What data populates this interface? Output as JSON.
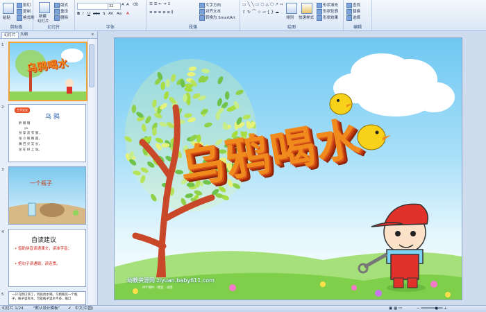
{
  "ribbon": {
    "groups": {
      "clipboard": "剪贴板",
      "slides": "幻灯片",
      "font": "字体",
      "paragraph": "段落",
      "drawing": "绘图",
      "editing": "编辑"
    },
    "clipboard": {
      "paste": "粘贴",
      "cut": "剪切",
      "copy": "复制",
      "format_painter": "格式刷"
    },
    "slides": {
      "new_slide": "新建",
      "new_slide2": "幻灯片",
      "layout": "版式",
      "reset": "重设",
      "delete": "删除"
    },
    "font": {
      "size": "32"
    },
    "paragraph": {
      "text_direction": "文字方向",
      "align_text": "对齐文本",
      "smartart": "转换为 SmartArt"
    },
    "drawing": {
      "arrange": "排列",
      "quick_styles": "快速样式",
      "shape_fill": "形状填充",
      "shape_outline": "形状轮廓",
      "shape_effects": "形状效果"
    },
    "editing": {
      "find": "查找",
      "replace": "替换",
      "select": "选择"
    }
  },
  "panel": {
    "tab_slides": "幻灯片",
    "tab_outline": "大纲",
    "thumbs": [
      {
        "num": "1",
        "title": "乌鸦喝水"
      },
      {
        "num": "2",
        "title": "乌 鸦",
        "header": "生字宝宝",
        "lines": [
          "胖 嘟 嘟",
          "ya",
          "身 穿 黑 衣 服 ，",
          "张 小 眼 睛 圆，",
          "嘴 巴 尖 又 长，",
          "总 在 树 上 站。"
        ]
      },
      {
        "num": "3",
        "title": "一个瓶子"
      },
      {
        "num": "4",
        "title": "自读建议",
        "bullets": [
          "借助拼音读通课文，读准字音；",
          "把句子读通顺，读连贯。"
        ]
      },
      {
        "num": "5",
        "text": "一只乌鸦口渴了，到处找水喝。乌鸦看见一个瓶子，瓶子里有水。可是瓶子里水不多，瓶口"
      }
    ]
  },
  "slide": {
    "title": "乌鸦喝水",
    "watermark": "幼教资源网 ziyuan.baby611.com",
    "watermark_sub": "PPT课件 · 教案 · 试卷"
  },
  "status": {
    "page": "幻灯片 1/24",
    "theme": "\"默认设计模板\"",
    "lang": "中文(中国)"
  },
  "colors": {
    "title_fill": "#f08a1c",
    "title_edge": "#c8370f",
    "tree_trunk": "#c9482a",
    "boy_cap": "#e0312a",
    "boy_overalls": "#e0312a",
    "grass": "#7fcf4a"
  }
}
